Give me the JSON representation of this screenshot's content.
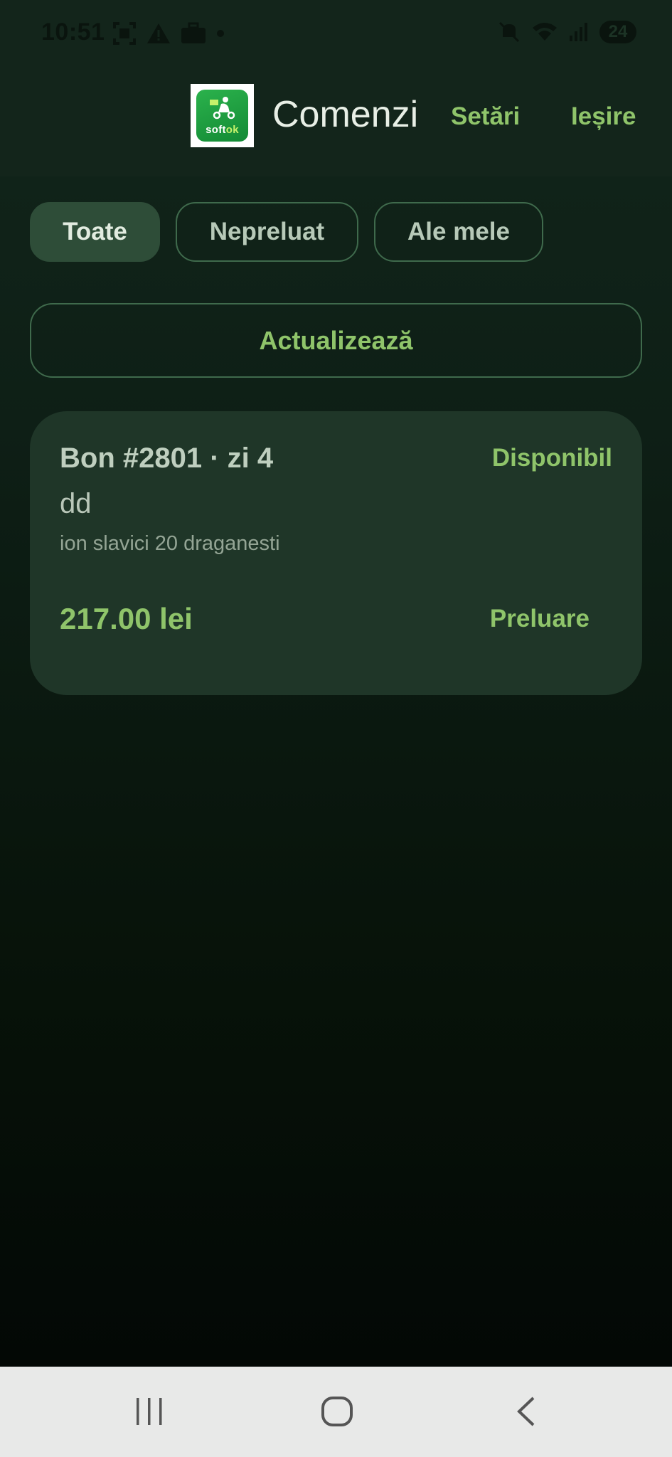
{
  "status_bar": {
    "time": "10:51",
    "battery": "24",
    "icons_left": [
      "screenshot-icon",
      "warning-icon",
      "briefcase-icon",
      "dot-icon"
    ],
    "icons_right": [
      "mute-icon",
      "wifi-icon",
      "signal-icon",
      "battery-icon"
    ]
  },
  "header": {
    "logo_text_a": "soft",
    "logo_text_b": "ok",
    "title": "Comenzi",
    "settings_label": "Setări",
    "exit_label": "Ieșire"
  },
  "filters": {
    "all_label": "Toate",
    "unclaimed_label": "Nepreluat",
    "mine_label": "Ale mele",
    "selected": "Toate"
  },
  "refresh_label": "Actualizează",
  "orders": [
    {
      "title": "Bon #2801 · zi 4",
      "status": "Disponibil",
      "customer": "dd",
      "address": "ion slavici 20 draganesti",
      "price": "217.00 lei",
      "action_label": "Preluare"
    }
  ],
  "colors": {
    "accent": "#8fc46a",
    "background": "#0e1f16",
    "card": "#1f3628",
    "chip_active": "#2e4d38"
  },
  "nav": {
    "items": [
      "recent-apps-icon",
      "home-icon",
      "back-icon"
    ]
  }
}
